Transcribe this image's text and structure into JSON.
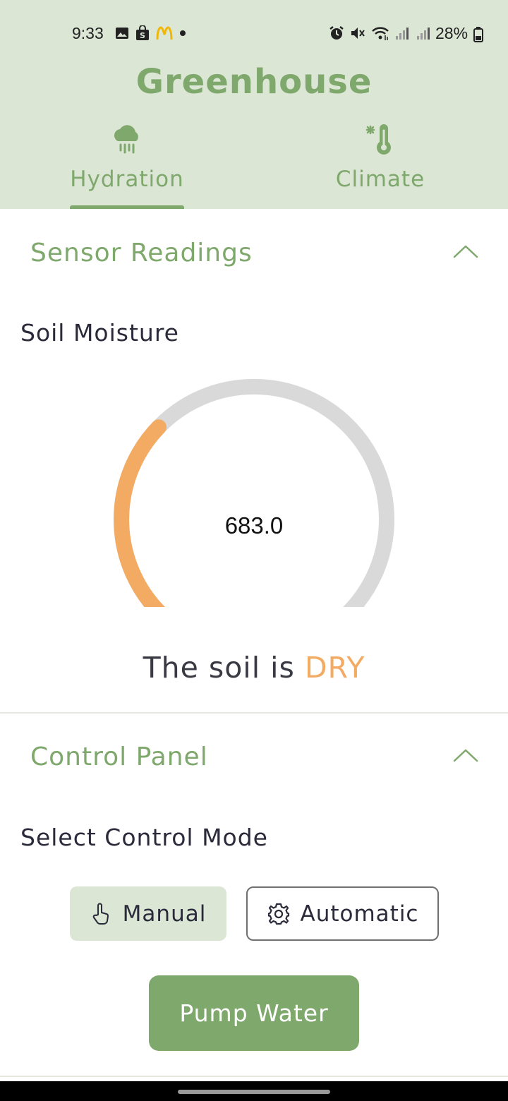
{
  "status_bar": {
    "time": "9:33",
    "battery": "28%",
    "left_icons": [
      "image-icon",
      "shopping-bag-icon",
      "mcdonalds-icon",
      "dot-icon"
    ],
    "right_icons": [
      "alarm-icon",
      "mute-icon",
      "wifi-icon",
      "signal-icon",
      "signal-icon",
      "battery-icon"
    ]
  },
  "app": {
    "title": "Greenhouse"
  },
  "tabs": [
    {
      "label": "Hydration",
      "icon": "rain-cloud-icon",
      "selected": true
    },
    {
      "label": "Climate",
      "icon": "thermometer-snow-icon",
      "selected": false
    }
  ],
  "sensor_section": {
    "title": "Sensor Readings",
    "label": "Soil Moisture",
    "reading": "683.0",
    "gauge_fill_fraction": 0.33,
    "status_prefix": "The soil is",
    "status_value": "DRY"
  },
  "control_section": {
    "title": "Control Panel",
    "mode_label": "Select Control Mode",
    "modes": [
      {
        "label": "Manual",
        "icon": "hand-pointer-icon",
        "selected": true
      },
      {
        "label": "Automatic",
        "icon": "gear-icon",
        "selected": false
      }
    ],
    "pump_button": "Pump Water"
  },
  "colors": {
    "accent": "#7fa86c",
    "header_bg": "#dbe6d5",
    "dry": "#f3ab63",
    "gauge_track": "#d9d9d9"
  }
}
